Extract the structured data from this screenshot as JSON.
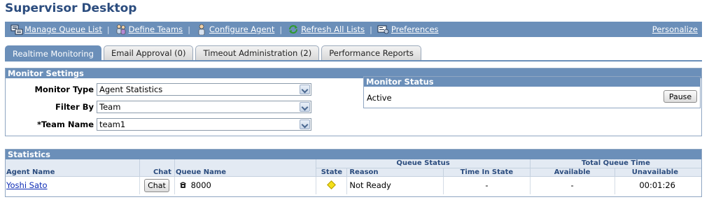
{
  "page": {
    "title": "Supervisor Desktop"
  },
  "nav": {
    "items": [
      {
        "label": "Manage Queue List",
        "icon": "queue-list-icon"
      },
      {
        "label": "Define Teams",
        "icon": "team-icon"
      },
      {
        "label": "Configure Agent",
        "icon": "agent-icon"
      },
      {
        "label": "Refresh All Lists",
        "icon": "refresh-icon"
      },
      {
        "label": "Preferences",
        "icon": "preferences-icon"
      }
    ],
    "personalize": "Personalize"
  },
  "tabs": [
    {
      "label": "Realtime Monitoring",
      "active": true
    },
    {
      "label": "Email Approval (0)",
      "active": false
    },
    {
      "label": "Timeout Administration (2)",
      "active": false
    },
    {
      "label": "Performance Reports",
      "active": false
    }
  ],
  "monitor_settings": {
    "title": "Monitor Settings",
    "fields": [
      {
        "label": "Monitor Type",
        "value": "Agent Statistics"
      },
      {
        "label": "Filter By",
        "value": "Team"
      },
      {
        "label": "*Team Name",
        "value": "team1"
      }
    ],
    "status": {
      "title": "Monitor Status",
      "value": "Active",
      "button": "Pause"
    }
  },
  "statistics": {
    "title": "Statistics",
    "group_headers": {
      "queue_status": "Queue Status",
      "total_queue_time": "Total Queue Time"
    },
    "columns": {
      "agent_name": "Agent Name",
      "chat": "Chat",
      "queue_name": "Queue Name",
      "state": "State",
      "reason": "Reason",
      "time_in_state": "Time In State",
      "available": "Available",
      "unavailable": "Unavailable"
    },
    "rows": [
      {
        "agent_name": "Yoshi Sato",
        "chat_button": "Chat",
        "queue_name": "8000",
        "state_icon": "yellow-diamond",
        "reason": "Not Ready",
        "time_in_state": "-",
        "available": "-",
        "unavailable": "00:01:26"
      }
    ]
  },
  "colors": {
    "header_blue": "#6b8fb9",
    "title_blue": "#2b4c7e",
    "state_yellow": "#f4e01a"
  }
}
